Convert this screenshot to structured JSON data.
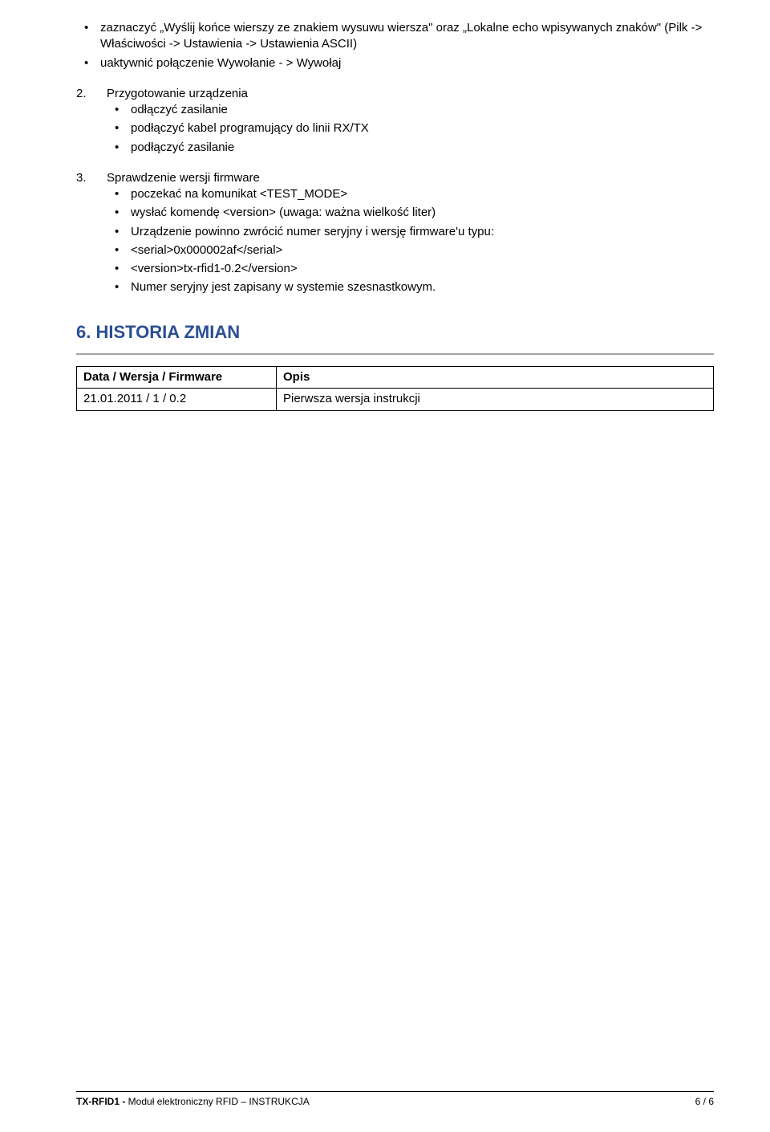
{
  "top_bullets": {
    "b1": "zaznaczyć „Wyślij końce wierszy ze znakiem wysuwu wiersza\" oraz „Lokalne echo wpisywanych znaków\" (Pilk -> Właściwości -> Ustawienia -> Ustawienia ASCII)",
    "b2": "uaktywnić połączenie Wywołanie - > Wywołaj"
  },
  "sec2": {
    "num": "2.",
    "title": "Przygotowanie urządzenia",
    "b1": "odłączyć zasilanie",
    "b2": "podłączyć kabel programujący do linii RX/TX",
    "b3": "podłączyć zasilanie"
  },
  "sec3": {
    "num": "3.",
    "title": "Sprawdzenie wersji firmware",
    "b1": "poczekać na komunikat <TEST_MODE>",
    "b2": "wysłać komendę <version>   (uwaga: ważna wielkość liter)",
    "b3": "Urządzenie powinno zwrócić numer seryjny i wersję firmware'u typu:",
    "b4": "<serial>0x000002af</serial>",
    "b5": "<version>tx-rfid1-0.2</version>",
    "b6": "Numer seryjny jest zapisany w systemie szesnastkowym."
  },
  "heading": "6. HISTORIA ZMIAN",
  "table": {
    "h1": "Data / Wersja / Firmware",
    "h2": "Opis",
    "r1c1": "21.01.2011 / 1 / 0.2",
    "r1c2": "Pierwsza wersja instrukcji"
  },
  "footer": {
    "left_bold": "TX-RFID1 - ",
    "left_rest": "Moduł elektroniczny RFID – INSTRUKCJA",
    "right": "6 / 6"
  }
}
